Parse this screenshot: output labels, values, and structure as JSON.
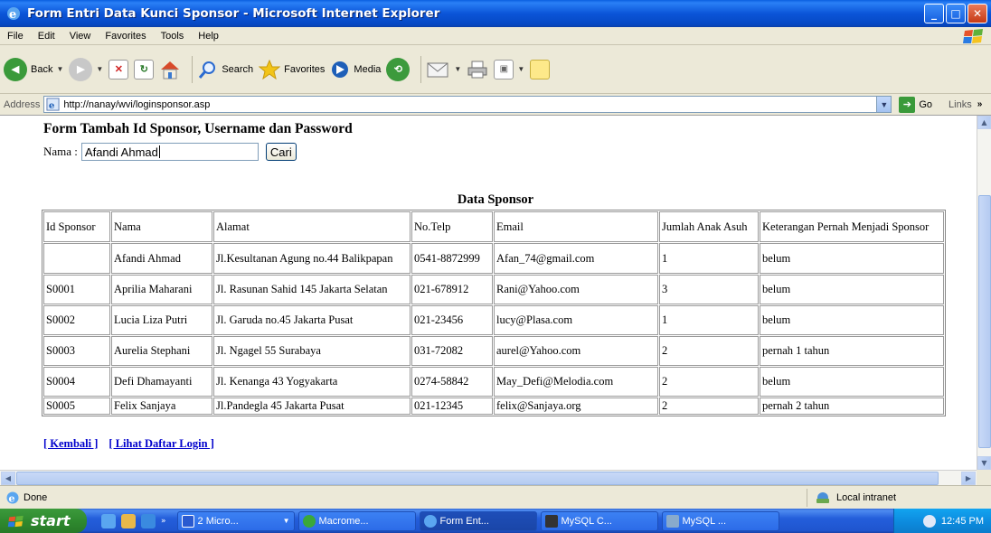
{
  "window": {
    "title": "Form Entri Data Kunci Sponsor - Microsoft Internet Explorer"
  },
  "menu": [
    "File",
    "Edit",
    "View",
    "Favorites",
    "Tools",
    "Help"
  ],
  "toolbar": {
    "back": "Back",
    "search": "Search",
    "favorites": "Favorites",
    "media": "Media"
  },
  "address": {
    "label": "Address",
    "url": "http://nanay/wvi/loginsponsor.asp",
    "go": "Go",
    "links": "Links"
  },
  "page": {
    "form_title": "Form Tambah Id Sponsor, Username dan Password",
    "search_label": "Nama :",
    "search_value": "Afandi Ahmad",
    "search_button": "Cari",
    "table_title": "Data Sponsor",
    "columns": [
      "Id Sponsor",
      "Nama",
      "Alamat",
      "No.Telp",
      "Email",
      "Jumlah Anak Asuh",
      "Keterangan Pernah Menjadi Sponsor"
    ],
    "rows": [
      [
        "",
        "Afandi Ahmad",
        "Jl.Kesultanan Agung no.44 Balikpapan",
        "0541-8872999",
        "Afan_74@gmail.com",
        "1",
        "belum"
      ],
      [
        "S0001",
        "Aprilia Maharani",
        "Jl. Rasunan Sahid 145 Jakarta Selatan",
        "021-678912",
        "Rani@Yahoo.com",
        "3",
        "belum"
      ],
      [
        "S0002",
        "Lucia Liza Putri",
        "Jl. Garuda no.45 Jakarta Pusat",
        "021-23456",
        "lucy@Plasa.com",
        "1",
        "belum"
      ],
      [
        "S0003",
        "Aurelia Stephani",
        "Jl. Ngagel 55 Surabaya",
        "031-72082",
        "aurel@Yahoo.com",
        "2",
        "pernah 1 tahun"
      ],
      [
        "S0004",
        "Defi Dhamayanti",
        "Jl. Kenanga 43 Yogyakarta",
        "0274-58842",
        "May_Defi@Melodia.com",
        "2",
        "belum"
      ],
      [
        "S0005",
        "Felix Sanjaya",
        "Jl.Pandegla 45 Jakarta Pusat",
        "021-12345",
        "felix@Sanjaya.org",
        "2",
        "pernah 2 tahun"
      ]
    ],
    "link_back": "[ Kembali ]",
    "link_list": "[ Lihat Daftar Login ]"
  },
  "status": {
    "text": "Done",
    "zone": "Local intranet"
  },
  "taskbar": {
    "start": "start",
    "tasks": [
      "2 Micro...",
      "Macrome...",
      "Form Ent...",
      "MySQL C...",
      "MySQL ..."
    ],
    "clock": "12:45 PM"
  },
  "colors": {
    "title_bar": "#0b55d8",
    "link": "#0000cc",
    "taskbar": "#245edb",
    "start": "#3c9a3c"
  }
}
